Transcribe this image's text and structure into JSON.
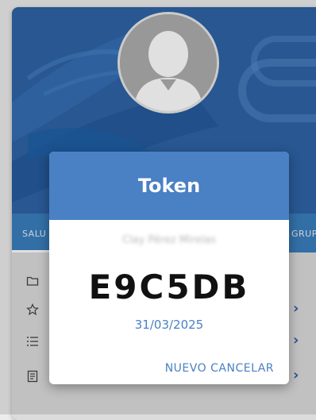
{
  "profile": {
    "tab_left": "SALU",
    "tab_right": "GRUP"
  },
  "list": {
    "items": [
      {
        "icon": "folder-icon"
      },
      {
        "icon": "star-icon"
      },
      {
        "icon": "list-icon"
      },
      {
        "icon": "document-icon"
      }
    ]
  },
  "dialog": {
    "title": "Token",
    "name": "Clay Pérez Mirelas",
    "token": "E9C5DB",
    "date": "31/03/2025",
    "new_label": "NUEVO",
    "cancel_label": "CANCELAR"
  },
  "colors": {
    "primary": "#4a80c4",
    "header_bg": "#2e63a5",
    "tab_bar": "#3a7fbd"
  }
}
